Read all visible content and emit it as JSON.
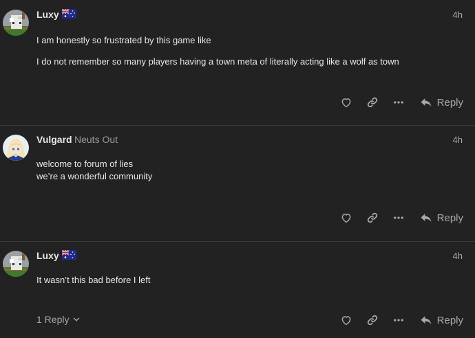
{
  "colors": {
    "background": "#222222",
    "text": "#e8e8e8",
    "muted": "#a8a8a8",
    "divider": "#3a3a3a"
  },
  "posts": [
    {
      "username": "Luxy",
      "user_title": "",
      "flag": "australia-flag",
      "time": "4h",
      "lines": [
        "I am honestly so frustrated by this game like",
        "I do not remember so many players having a town meta of literally acting like a wolf as town"
      ],
      "reply_label": "Reply"
    },
    {
      "username": "Vulgard",
      "user_title": "Neuts Out",
      "time": "4h",
      "lines": [
        "welcome to forum of lies",
        "we’re a wonderful community"
      ],
      "reply_label": "Reply"
    },
    {
      "username": "Luxy",
      "user_title": "",
      "flag": "australia-flag",
      "time": "4h",
      "lines": [
        "It wasn’t this bad before I left"
      ],
      "replies_count_label": "1 Reply",
      "reply_label": "Reply"
    }
  ],
  "icons": {
    "like": "heart-icon",
    "share": "link-icon",
    "more": "more-options-icon",
    "reply": "reply-arrow-icon",
    "expand": "chevron-down-icon"
  }
}
